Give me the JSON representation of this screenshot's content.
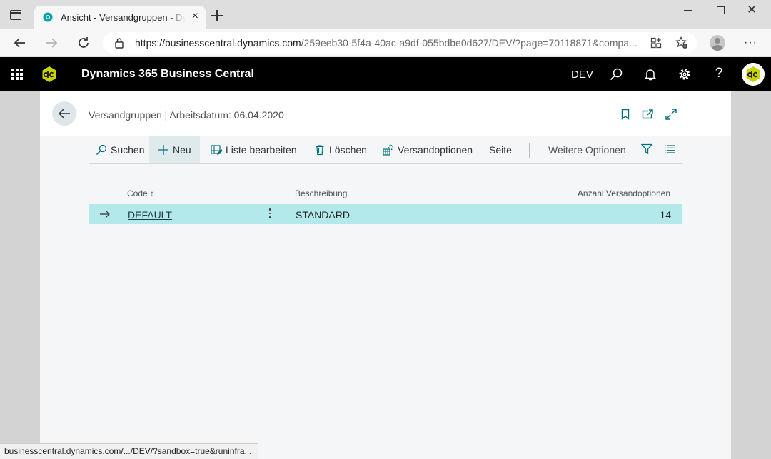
{
  "browser": {
    "tab_title": "Ansicht - Versandgruppen - Dynamics 365 Business Central",
    "tab_close": "×",
    "window_close": "✕",
    "url_host": "https://businesscentral.dynamics.com",
    "url_path": "/259eeb30-5f4a-40ac-a9df-055bdbe0d627/DEV/?page=70118871&compa...",
    "menu_dots": "···",
    "status_url": "businesscentral.dynamics.com/.../DEV/?sandbox=true&runinfra..."
  },
  "header": {
    "product_name": "Dynamics 365 Business Central",
    "environment": "DEV",
    "icons": [
      "waffle-icon",
      "search-icon",
      "bell-icon",
      "gear-icon",
      "help-icon"
    ],
    "help_label": "?"
  },
  "page": {
    "title": "Versandgruppen | Arbeitsdatum: 06.04.2020",
    "actions": {
      "search": "Suchen",
      "new": "Neu",
      "edit_list": "Liste bearbeiten",
      "delete": "Löschen",
      "shipping_options": "Versandoptionen",
      "page": "Seite",
      "more_options": "Weitere Optionen"
    },
    "columns": {
      "code": "Code ↑",
      "description": "Beschreibung",
      "count": "Anzahl Versandoptionen"
    },
    "rows": [
      {
        "code": "DEFAULT",
        "description": "STANDARD",
        "count": "14"
      }
    ]
  },
  "colors": {
    "header_bg": "#000000",
    "accent_teal": "#00a3a4",
    "selected_row": "#b3e9ea",
    "logo_yellow": "#c8d400"
  }
}
